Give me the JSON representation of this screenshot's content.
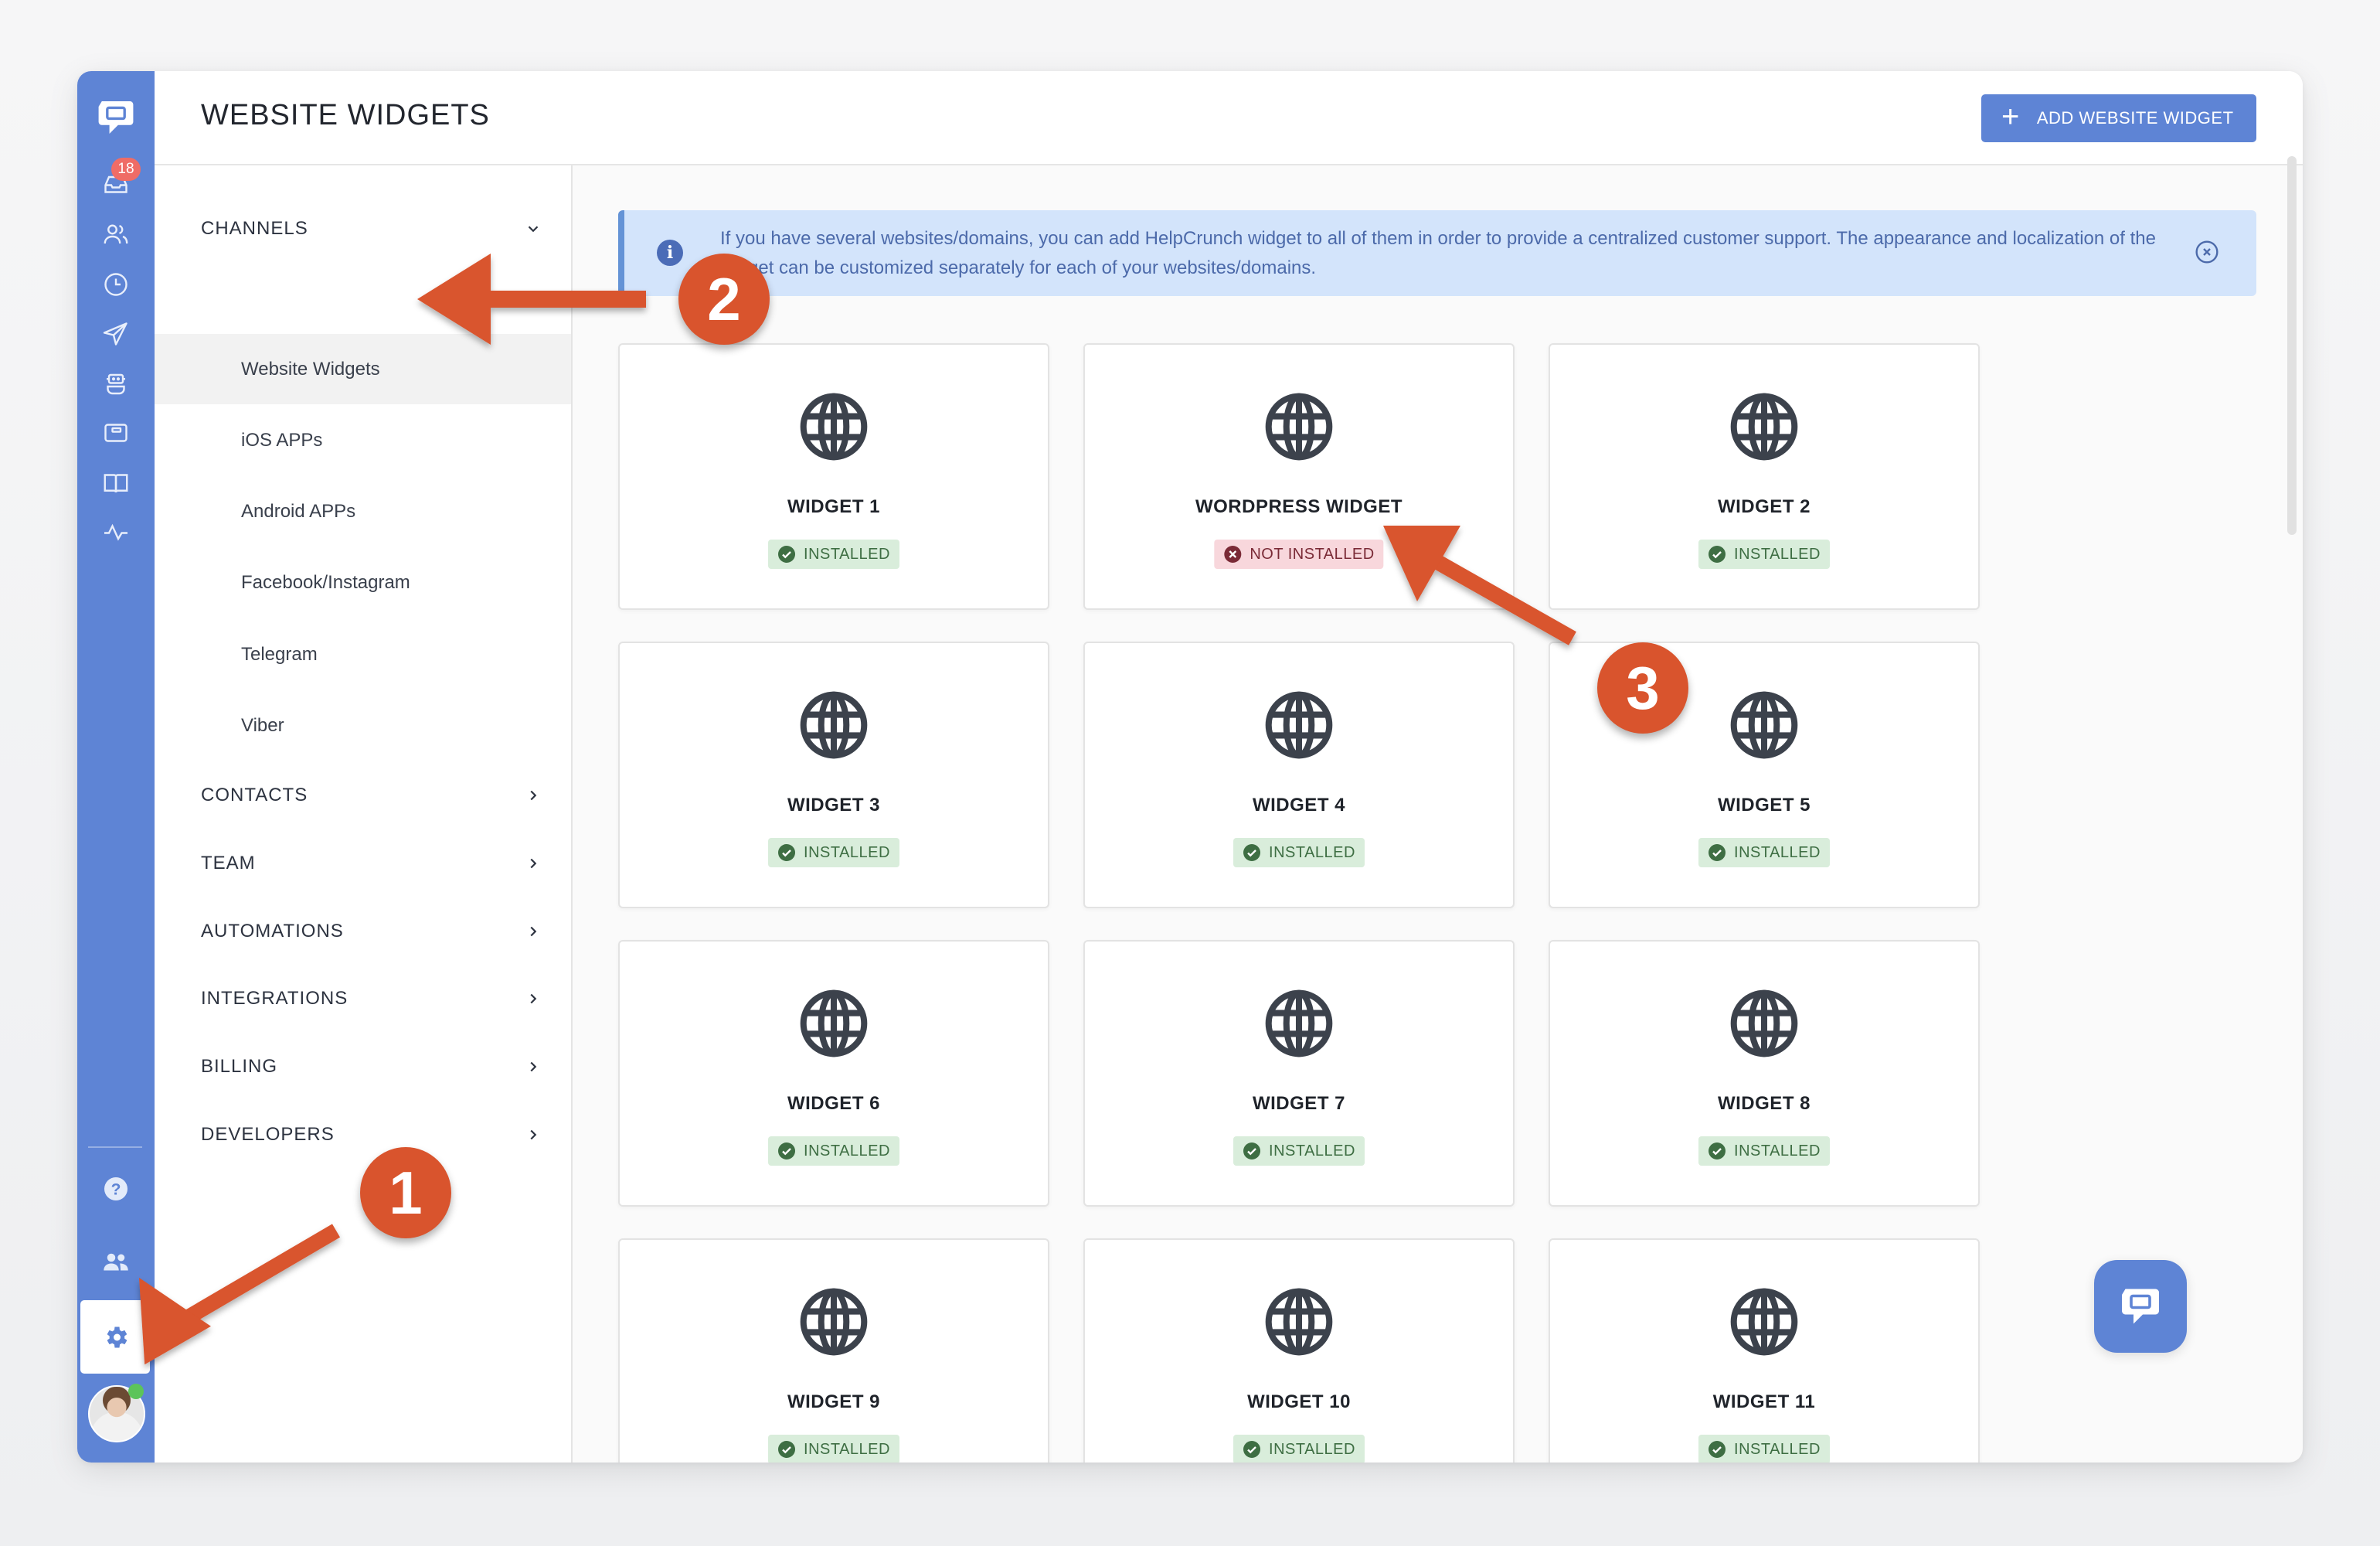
{
  "app": {
    "brand_color": "#5e84d5",
    "page_title": "WEBSITE WIDGETS",
    "add_button_label": "ADD WEBSITE WIDGET"
  },
  "rail": {
    "logo": "chat-logo-icon",
    "items": [
      {
        "icon": "inbox-icon",
        "badge": "18"
      },
      {
        "icon": "users-icon"
      },
      {
        "icon": "clock-icon"
      },
      {
        "icon": "send-icon"
      },
      {
        "icon": "bot-icon"
      },
      {
        "icon": "widget-icon"
      },
      {
        "icon": "book-icon"
      },
      {
        "icon": "activity-icon"
      }
    ],
    "bottom_items": [
      {
        "icon": "help-icon"
      },
      {
        "icon": "team-icon"
      },
      {
        "icon": "settings-icon",
        "active": true
      }
    ],
    "avatar_status": "online"
  },
  "submenu": {
    "sections": [
      {
        "label": "CHANNELS",
        "expanded": true,
        "items": [
          {
            "label": "Website Widgets",
            "active": true
          },
          {
            "label": "iOS APPs"
          },
          {
            "label": "Android APPs"
          },
          {
            "label": "Facebook/Instagram"
          },
          {
            "label": "Telegram"
          },
          {
            "label": "Viber"
          }
        ]
      },
      {
        "label": "CONTACTS"
      },
      {
        "label": "TEAM"
      },
      {
        "label": "AUTOMATIONS"
      },
      {
        "label": "INTEGRATIONS"
      },
      {
        "label": "BILLING"
      },
      {
        "label": "DEVELOPERS"
      }
    ]
  },
  "banner": {
    "text": "If you have several websites/domains, you can add HelpCrunch widget to all of them in order to provide a centralized customer support. The appearance and localization of the widget can be customized separately for each of your websites/domains."
  },
  "widgets": [
    {
      "name": "WIDGET 1",
      "status": "INSTALLED",
      "installed": true
    },
    {
      "name": "WORDPRESS WIDGET",
      "status": "NOT INSTALLED",
      "installed": false
    },
    {
      "name": "WIDGET 2",
      "status": "INSTALLED",
      "installed": true
    },
    {
      "name": "WIDGET 3",
      "status": "INSTALLED",
      "installed": true
    },
    {
      "name": "WIDGET 4",
      "status": "INSTALLED",
      "installed": true
    },
    {
      "name": "WIDGET 5",
      "status": "INSTALLED",
      "installed": true
    },
    {
      "name": "WIDGET 6",
      "status": "INSTALLED",
      "installed": true
    },
    {
      "name": "WIDGET 7",
      "status": "INSTALLED",
      "installed": true
    },
    {
      "name": "WIDGET 8",
      "status": "INSTALLED",
      "installed": true
    },
    {
      "name": "WIDGET 9",
      "status": "INSTALLED",
      "installed": true
    },
    {
      "name": "WIDGET 10",
      "status": "INSTALLED",
      "installed": true
    },
    {
      "name": "WIDGET 11",
      "status": "INSTALLED",
      "installed": true
    }
  ],
  "annotations": [
    {
      "number": "1",
      "target": "settings"
    },
    {
      "number": "2",
      "target": "Website Widgets"
    },
    {
      "number": "3",
      "target": "WORDPRESS WIDGET status"
    }
  ],
  "colors": {
    "installed_bg": "#d9eddb",
    "installed_fg": "#3e6e43",
    "not_installed_bg": "#f8d7dc",
    "not_installed_fg": "#7a2a36",
    "annotation": "#d9542d",
    "banner_bg": "#d3e4fb"
  }
}
